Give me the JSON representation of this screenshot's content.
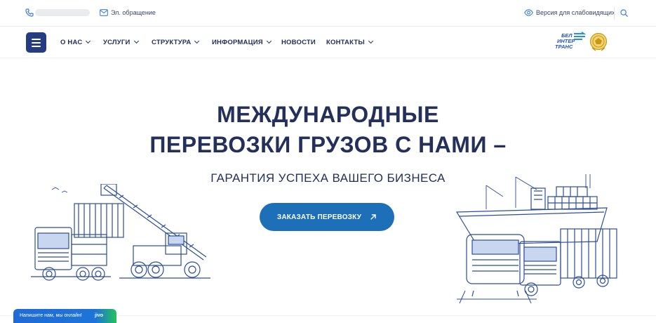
{
  "topbar": {
    "phone_icon": "phone-icon",
    "email_label": "Эл. обращение",
    "visually_impaired_label": "Версия для слабовидящих",
    "search_icon": "search-icon"
  },
  "nav": {
    "menu_icon": "burger-menu-icon",
    "items": [
      {
        "label": "О НАС",
        "dropdown": true
      },
      {
        "label": "УСЛУГИ",
        "dropdown": true
      },
      {
        "label": "СТРУКТУРА",
        "dropdown": true
      },
      {
        "label": "ИНФОРМАЦИЯ",
        "dropdown": true
      },
      {
        "label": "НОВОСТИ",
        "dropdown": false
      },
      {
        "label": "КОНТАКТЫ",
        "dropdown": true
      }
    ],
    "logo_lines": [
      "БЕЛ",
      "ИНТЕР",
      "ТРАНС"
    ]
  },
  "hero": {
    "title_line1": "МЕЖДУНАРОДНЫЕ",
    "title_line2": "ПЕРЕВОЗКИ ГРУЗОВ С НАМИ –",
    "subtitle": "ГАРАНТИЯ УСПЕХА ВАШЕГО БИЗНЕСА",
    "cta_label": "ЗАКАЗАТЬ ПЕРЕВОЗКУ"
  },
  "chat": {
    "label": "Напишите нам, мы онлайн!",
    "brand": "jivo"
  },
  "colors": {
    "brand_navy": "#23305a",
    "button_blue": "#1d6fb8",
    "menu_button": "#253b82",
    "chat_blue": "#1f6bd6",
    "chat_green": "#23c25a"
  }
}
